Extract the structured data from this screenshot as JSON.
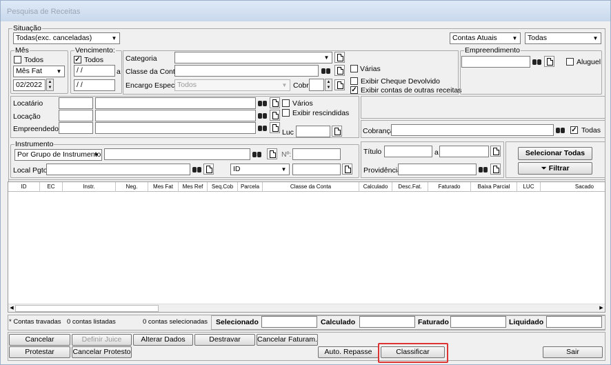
{
  "window": {
    "title": "Pesquisa de Receitas"
  },
  "situacao": {
    "label": "Situação",
    "value": "Todas(exc. canceladas)",
    "contas": "Contas Atuais",
    "todas": "Todas"
  },
  "mes": {
    "label": "Mês",
    "todos": "Todos",
    "tipo": "Mês Fat",
    "valor": "02/2022"
  },
  "vencimento": {
    "label": "Vencimento:",
    "todos": "Todos",
    "de": " / /",
    "a": "a",
    "ate": " / /"
  },
  "categoria": {
    "label": "Categoria",
    "classe_label": "Classe da Conta",
    "encargo_label": "Encargo Espec.",
    "encargo_value": "Todos",
    "cobr_label": "Cobr",
    "varias": "Várias",
    "exibir_cheque": "Exibir Cheque Devolvido",
    "exibir_contas": "Exibir contas de outras receitas"
  },
  "empreendimento": {
    "label": "Empreendimento",
    "aluguel": "Aluguel"
  },
  "pessoas": {
    "locatario": "Locatário",
    "locacao": "Locação",
    "empreendedor": "Empreendedor",
    "varios": "Vários",
    "exibir_rescindidas": "Exibir rescindidas",
    "luc": "Luc"
  },
  "cobranca": {
    "label": "Cobrança",
    "todas": "Todas"
  },
  "instrumento": {
    "label": "Instrumento",
    "value": "Por Grupo de Instrumento",
    "num": "Nº:",
    "local_label": "Local Pgto",
    "id_value": "ID"
  },
  "titulo": {
    "label": "Título",
    "a": "a",
    "providencia": "Providência"
  },
  "buttons": {
    "selecionar": "Selecionar Todas",
    "filtrar": "Filtrar",
    "cancelar": "Cancelar",
    "definir_juice": "Definir Juice",
    "alterar_dados": "Alterar Dados",
    "destravar": "Destravar",
    "cancelar_faturam": "Cancelar Faturam.",
    "protestar": "Protestar",
    "cancelar_protesto": "Cancelar Protesto",
    "auto_repasse": "Auto. Repasse",
    "classificar": "Classificar",
    "sair": "Sair"
  },
  "grid": {
    "columns": [
      "ID",
      "EC",
      "Instr.",
      "Neg.",
      "Mes Fat",
      "Mes Ref",
      "Seq.Cob",
      "Parcela",
      "Classe da Conta",
      "Calculado",
      "Desc.Fat.",
      "Faturado",
      "Baixa Parcial",
      "LUC",
      "Sacado"
    ]
  },
  "status": {
    "travadas": "* Contas travadas",
    "listadas": "0 contas listadas",
    "selecionadas": "0 contas selecionadas",
    "selecionado": "Selecionado",
    "calculado": "Calculado",
    "faturado": "Faturado",
    "liquidado": "Liquidado"
  }
}
